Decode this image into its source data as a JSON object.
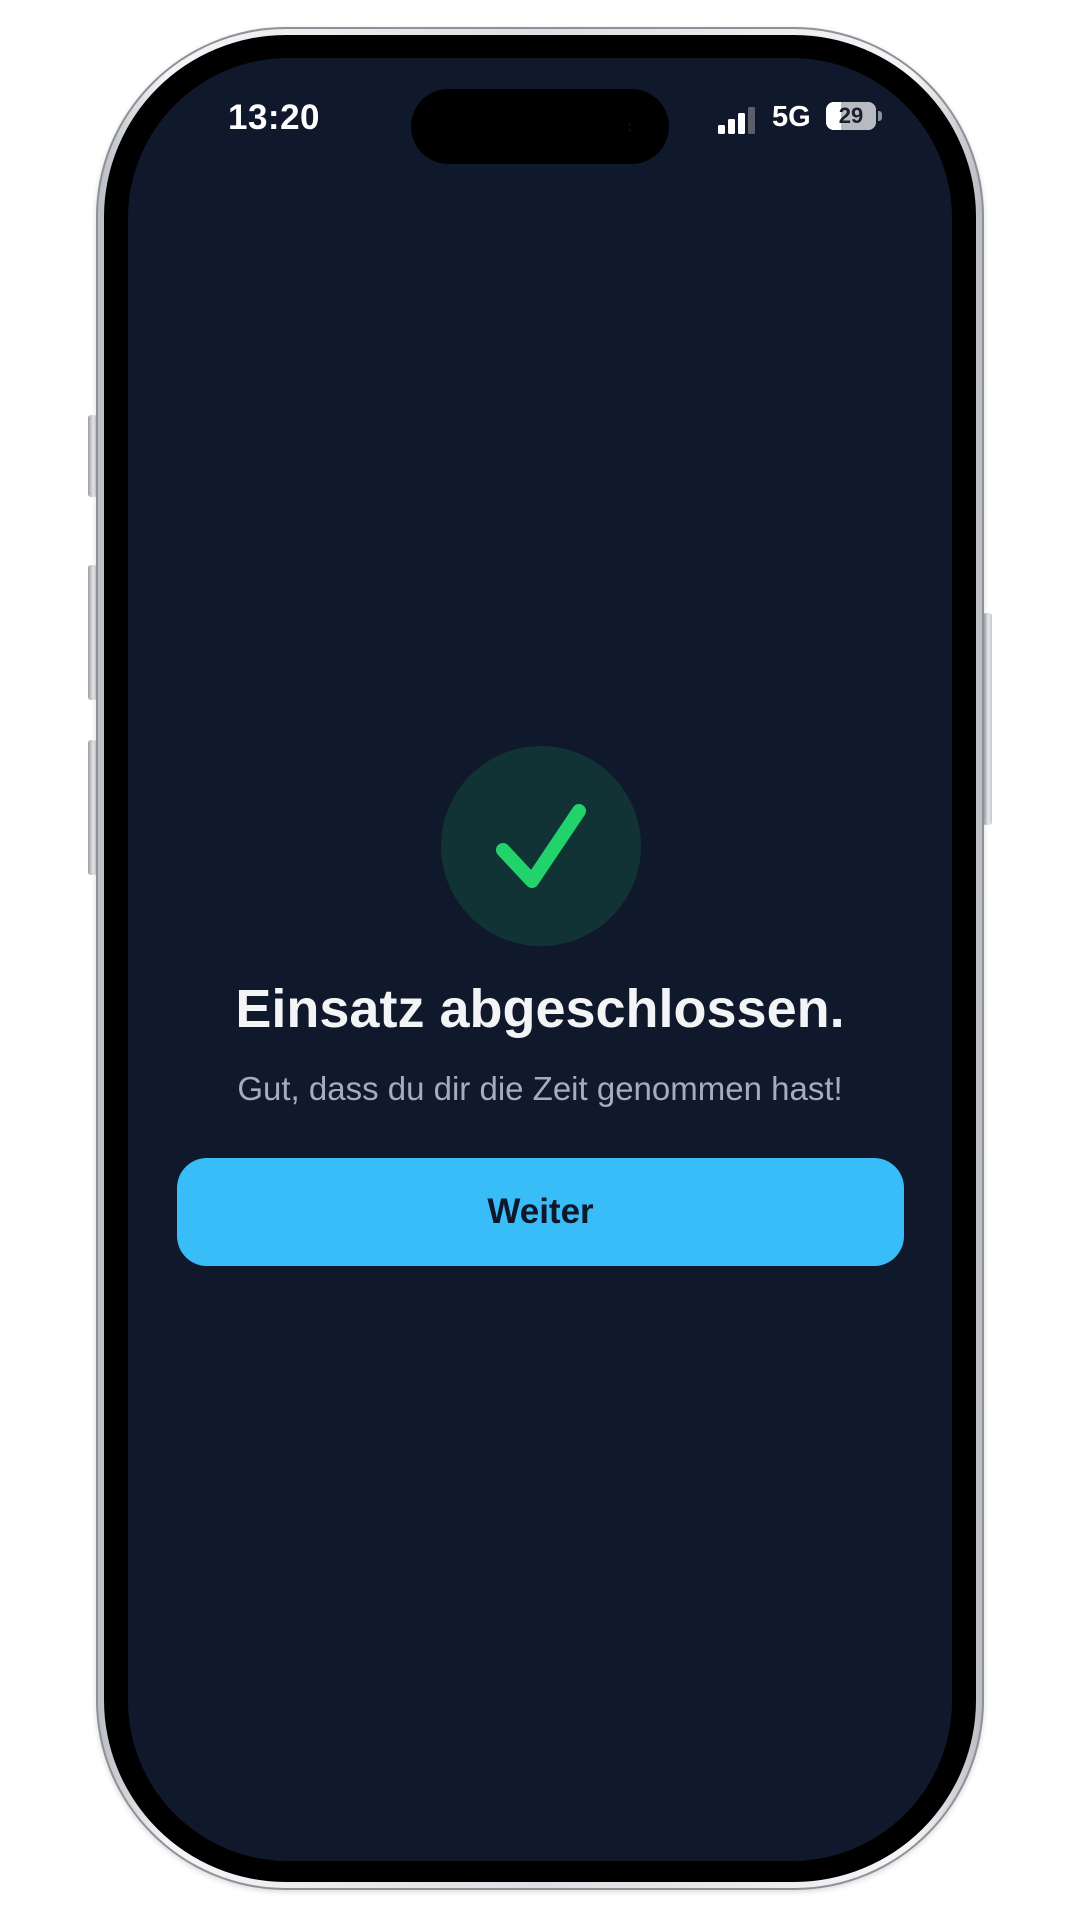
{
  "status_bar": {
    "time": "13:20",
    "network": "5G",
    "battery_percent": "29",
    "signal_bars_active": 3,
    "signal_bars_total": 4
  },
  "completion": {
    "icon": "checkmark-icon",
    "title": "Einsatz abgeschlossen.",
    "message": "Gut, dass du dir die Zeit genommen hast!",
    "continue_label": "Weiter"
  },
  "colors": {
    "background": "#10182b",
    "accent_button": "#38bdf8",
    "success_green": "#22d36b",
    "success_circle": "#113336"
  }
}
